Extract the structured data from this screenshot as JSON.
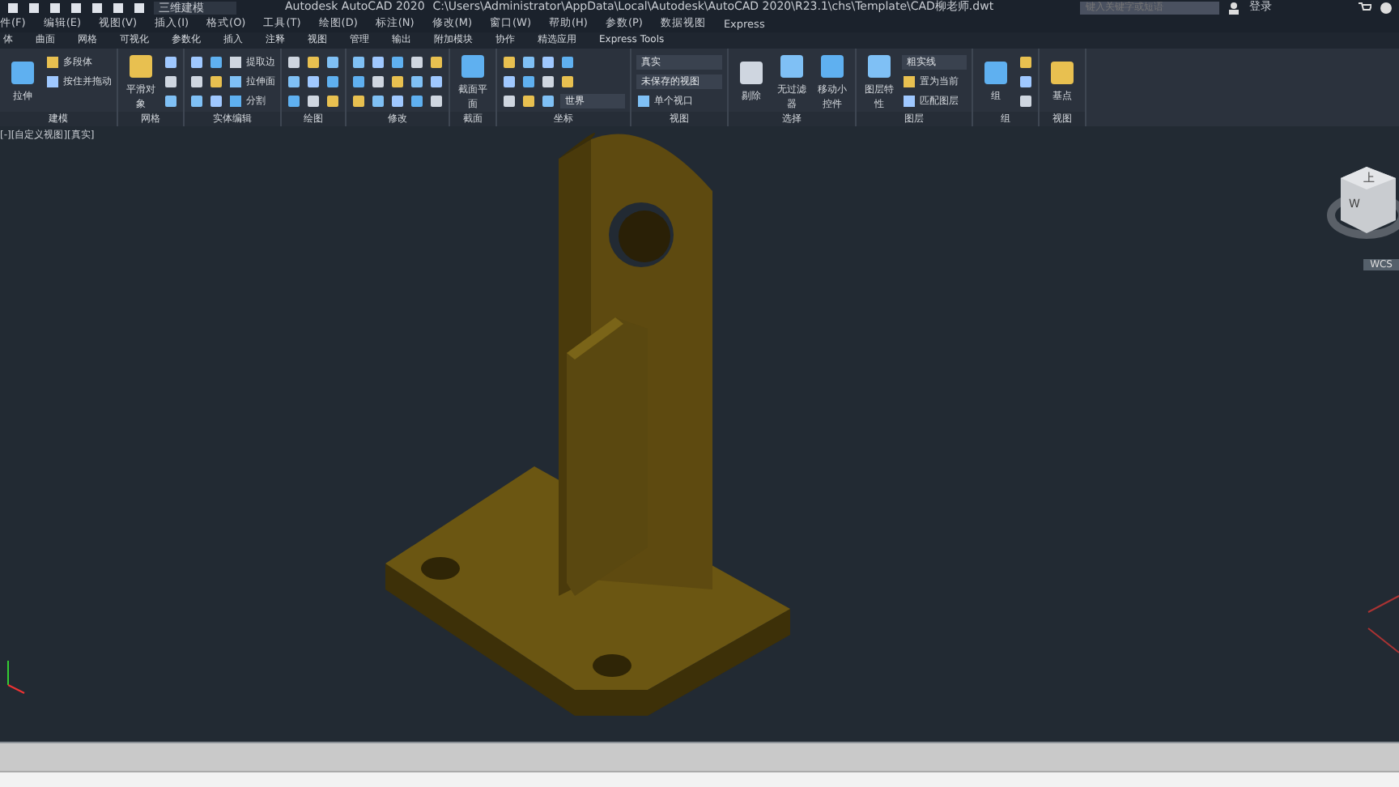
{
  "title_bar": {
    "workspace": "三维建模",
    "app_title": "Autodesk AutoCAD 2020",
    "file_path": "C:\\Users\\Administrator\\AppData\\Local\\Autodesk\\AutoCAD 2020\\R23.1\\chs\\Template\\CAD柳老师.dwt",
    "search_placeholder": "键入关键字或短语",
    "sign_in": "登录"
  },
  "menu_bar": [
    "件(F)",
    "编辑(E)",
    "视图(V)",
    "插入(I)",
    "格式(O)",
    "工具(T)",
    "绘图(D)",
    "标注(N)",
    "修改(M)",
    "窗口(W)",
    "帮助(H)",
    "参数(P)",
    "数据视图",
    "Express"
  ],
  "ribbon_tabs": [
    {
      "label": "体",
      "selected": false
    },
    {
      "label": "曲面",
      "selected": false
    },
    {
      "label": "网格",
      "selected": false
    },
    {
      "label": "可视化",
      "selected": false
    },
    {
      "label": "参数化",
      "selected": false
    },
    {
      "label": "插入",
      "selected": false
    },
    {
      "label": "注释",
      "selected": false
    },
    {
      "label": "视图",
      "selected": false
    },
    {
      "label": "管理",
      "selected": false
    },
    {
      "label": "输出",
      "selected": false
    },
    {
      "label": "附加模块",
      "selected": false
    },
    {
      "label": "协作",
      "selected": false
    },
    {
      "label": "精选应用",
      "selected": false
    },
    {
      "label": "Express Tools",
      "selected": false
    }
  ],
  "ribbon_panels": [
    {
      "title": "建模",
      "tools": [
        {
          "kind": "large",
          "label": "拉伸"
        },
        {
          "kind": "small",
          "label": "多段体"
        },
        {
          "kind": "small",
          "label": "按住并拖动"
        }
      ]
    },
    {
      "title": "网格",
      "tools": [
        {
          "kind": "large",
          "label": "平滑对象"
        },
        {
          "kind": "icon"
        },
        {
          "kind": "icon"
        },
        {
          "kind": "icon"
        }
      ]
    },
    {
      "title": "实体编辑",
      "tools": [
        {
          "kind": "icon"
        },
        {
          "kind": "icon"
        },
        {
          "kind": "icon"
        },
        {
          "kind": "icon"
        },
        {
          "kind": "icon"
        },
        {
          "kind": "icon"
        },
        {
          "kind": "small",
          "label": "提取边"
        },
        {
          "kind": "small",
          "label": "拉伸面"
        },
        {
          "kind": "small",
          "label": "分割"
        }
      ]
    },
    {
      "title": "绘图",
      "tools": [
        {
          "kind": "icon"
        },
        {
          "kind": "icon"
        },
        {
          "kind": "icon"
        },
        {
          "kind": "icon"
        },
        {
          "kind": "icon"
        },
        {
          "kind": "icon"
        },
        {
          "kind": "icon"
        },
        {
          "kind": "icon"
        },
        {
          "kind": "icon"
        }
      ]
    },
    {
      "title": "修改",
      "tools": [
        {
          "kind": "icon"
        },
        {
          "kind": "icon"
        },
        {
          "kind": "icon"
        },
        {
          "kind": "icon"
        },
        {
          "kind": "icon"
        },
        {
          "kind": "icon"
        },
        {
          "kind": "icon"
        },
        {
          "kind": "icon"
        },
        {
          "kind": "icon"
        },
        {
          "kind": "icon"
        },
        {
          "kind": "icon"
        },
        {
          "kind": "icon"
        },
        {
          "kind": "icon"
        },
        {
          "kind": "icon"
        },
        {
          "kind": "icon"
        }
      ]
    },
    {
      "title": "截面",
      "tools": [
        {
          "kind": "large",
          "label": "截面平面"
        }
      ]
    },
    {
      "title": "坐标",
      "tools": [
        {
          "kind": "icon"
        },
        {
          "kind": "icon"
        },
        {
          "kind": "icon"
        },
        {
          "kind": "icon"
        },
        {
          "kind": "icon"
        },
        {
          "kind": "icon"
        },
        {
          "kind": "icon"
        },
        {
          "kind": "icon"
        },
        {
          "kind": "icon"
        },
        {
          "kind": "icon"
        },
        {
          "kind": "icon"
        },
        {
          "kind": "dropdown",
          "label": "世界"
        }
      ]
    },
    {
      "title": "视图",
      "tools": [
        {
          "kind": "dropdown",
          "label": "真实"
        },
        {
          "kind": "dropdown",
          "label": "未保存的视图"
        },
        {
          "kind": "small",
          "label": "单个视口"
        }
      ]
    },
    {
      "title": "选择",
      "tools": [
        {
          "kind": "large",
          "label": "剔除"
        },
        {
          "kind": "large",
          "label": "无过滤器"
        },
        {
          "kind": "large",
          "label": "移动小控件"
        }
      ]
    },
    {
      "title": "图层",
      "tools": [
        {
          "kind": "large",
          "label": "图层特性"
        },
        {
          "kind": "dropdown",
          "label": "粗实线"
        },
        {
          "kind": "small",
          "label": "置为当前"
        },
        {
          "kind": "small",
          "label": "匹配图层"
        }
      ]
    },
    {
      "title": "组",
      "tools": [
        {
          "kind": "large",
          "label": "组"
        },
        {
          "kind": "icon"
        },
        {
          "kind": "icon"
        },
        {
          "kind": "icon"
        }
      ]
    },
    {
      "title": "视图",
      "tools": [
        {
          "kind": "large",
          "label": "基点"
        }
      ]
    }
  ],
  "viewport": {
    "label": "[-][自定义视图][真实]",
    "view_cube": {
      "top_face": "上",
      "west_face": "W",
      "ucs_label": "WCS"
    }
  }
}
